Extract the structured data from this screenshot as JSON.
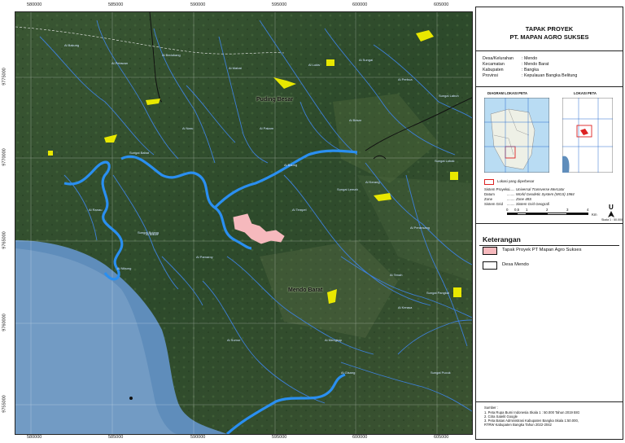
{
  "map": {
    "top_x_ticks": [
      "580000",
      "585000",
      "590000",
      "595000",
      "600000",
      "605000"
    ],
    "bottom_x_ticks": [
      "580000",
      "585000",
      "590000",
      "595000",
      "600000",
      "605000"
    ],
    "left_y_ticks": [
      "9775000",
      "9770000",
      "9765000",
      "9760000",
      "9755000"
    ],
    "right_y_ticks": [
      "9775000",
      "9770000",
      "9765000",
      "9760000",
      "9755000"
    ],
    "place_labels": {
      "pudingbesar": "Puding Besar",
      "mendobarat": "Mendo Barat"
    },
    "river_labels": [
      "Ai Bakung",
      "Ai Pelawan",
      "Ai Bedukang",
      "Sungai Babat",
      "Ai Mabat",
      "Ai Lukis",
      "Ai Sungai",
      "Ai Perbua",
      "Ai Ranau",
      "Ai Buluh",
      "Ai Pamaroy",
      "Sungai Lobak",
      "Ai Baung",
      "Sungai Pangkal",
      "Ai Nibung",
      "Ai Kerang",
      "Ai Tenah",
      "Ai Besar",
      "Ai Peransang",
      "Ai Mengkap",
      "Sungai Bujang",
      "Ai Tempel",
      "Ai Kerasa",
      "Ai Gisang",
      "Ai Sumur",
      "Ai Naru",
      "Ai Pakam",
      "Sungai Lemah",
      "Sungai Labuh",
      "Sungai Pucuk"
    ]
  },
  "panel": {
    "title_line1": "TAPAK PROYEK",
    "title_line2": "PT. MAPAN AGRO SUKSES",
    "info": [
      {
        "label": "Desa/Kelurahan",
        "value": ": Mendo"
      },
      {
        "label": "Kecamatan",
        "value": ": Mendo Barat"
      },
      {
        "label": "Kabupaten",
        "value": ": Bangka"
      },
      {
        "label": "Provinsi",
        "value": ": Kepulauan Bangka Belitung"
      }
    ],
    "diagram_title": "DIAGRAM LOKASI PETA",
    "lokasi_title": "LOKASI PETA",
    "selected_label": "Lokasi yang diperbesar",
    "projection": [
      {
        "label": "Sistem Proyeksi",
        "value": "........ Universal Transverse Mercator"
      },
      {
        "label": "Datum",
        "value": "........ World Geodetic System (WGS) 1984"
      },
      {
        "label": "Zone",
        "value": "........ Zone 48S"
      },
      {
        "label": "Sistem Grid",
        "value": "........ Sistem Grid Geografi"
      }
    ],
    "scale_numbers": [
      "0",
      "0,5",
      "1",
      "2",
      "3",
      "4"
    ],
    "scale_unit": "Km",
    "north": "U",
    "scale_text": "Skala 1 : 50.000",
    "keterangan": "Keterangan",
    "legend": [
      {
        "label": "Tapak Proyek PT Mapan Agro Sukses",
        "color": "#f4b8b8"
      },
      {
        "label": "Desa Mendo",
        "color": "#ffffff"
      }
    ],
    "source_title": "Sumber :",
    "sources": [
      "1. Peta Rupa Bumi Indonesia Skala 1 : 50.000 Tahun 2019 BIG",
      "2. Citra Satelit Google",
      "3. Peta Batas Administrasi Kabupaten Bangka Skala 1:50.000,",
      "   RTRW Kabupaten Bangka Tahun 2022-2042"
    ]
  },
  "colors": {
    "river": "#2a8ff0",
    "river_small": "#3d7fd8",
    "project": "#f6b9bd",
    "settlement": "#e8e800",
    "sea": "#5f8dbb"
  }
}
